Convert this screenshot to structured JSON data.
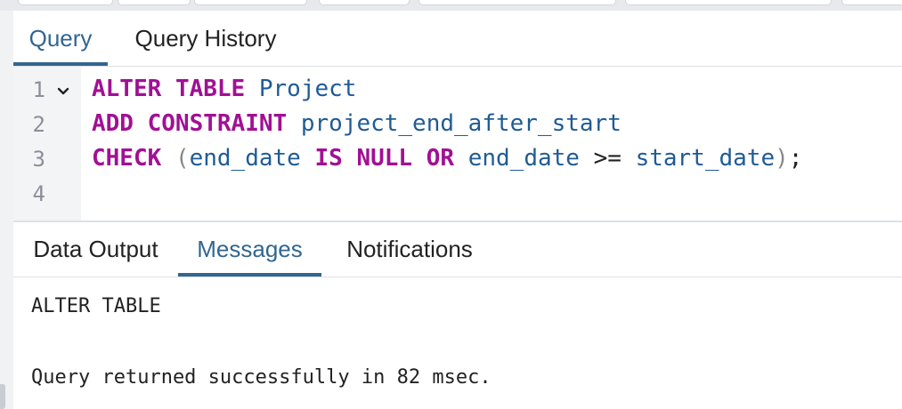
{
  "query_tabs": [
    {
      "label": "Query",
      "active": true
    },
    {
      "label": "Query History",
      "active": false
    }
  ],
  "editor": {
    "line_numbers": [
      "1",
      "2",
      "3",
      "4"
    ],
    "lines": [
      [
        {
          "t": "ALTER",
          "c": "kw"
        },
        {
          "t": " ",
          "c": "op"
        },
        {
          "t": "TABLE",
          "c": "kw"
        },
        {
          "t": " ",
          "c": "op"
        },
        {
          "t": "Project",
          "c": "id"
        }
      ],
      [
        {
          "t": "ADD",
          "c": "kw"
        },
        {
          "t": " ",
          "c": "op"
        },
        {
          "t": "CONSTRAINT",
          "c": "kw"
        },
        {
          "t": " ",
          "c": "op"
        },
        {
          "t": "project_end_after_start",
          "c": "id"
        }
      ],
      [
        {
          "t": "CHECK",
          "c": "kw"
        },
        {
          "t": " ",
          "c": "op"
        },
        {
          "t": "(",
          "c": "pn"
        },
        {
          "t": "end_date",
          "c": "id"
        },
        {
          "t": " ",
          "c": "op"
        },
        {
          "t": "IS",
          "c": "kw"
        },
        {
          "t": " ",
          "c": "op"
        },
        {
          "t": "NULL",
          "c": "kw"
        },
        {
          "t": " ",
          "c": "op"
        },
        {
          "t": "OR",
          "c": "kw"
        },
        {
          "t": " ",
          "c": "op"
        },
        {
          "t": "end_date",
          "c": "id"
        },
        {
          "t": " >= ",
          "c": "op"
        },
        {
          "t": "start_date",
          "c": "id"
        },
        {
          "t": ")",
          "c": "pn"
        },
        {
          "t": ";",
          "c": "sc"
        }
      ],
      []
    ]
  },
  "result_tabs": [
    {
      "label": "Data Output",
      "active": false
    },
    {
      "label": "Messages",
      "active": true
    },
    {
      "label": "Notifications",
      "active": false
    }
  ],
  "messages": {
    "line1": "ALTER TABLE",
    "line2": "Query returned successfully in 82 msec."
  },
  "colors": {
    "accent": "#326690",
    "keyword": "#a11094",
    "identifier": "#1f5b96"
  }
}
